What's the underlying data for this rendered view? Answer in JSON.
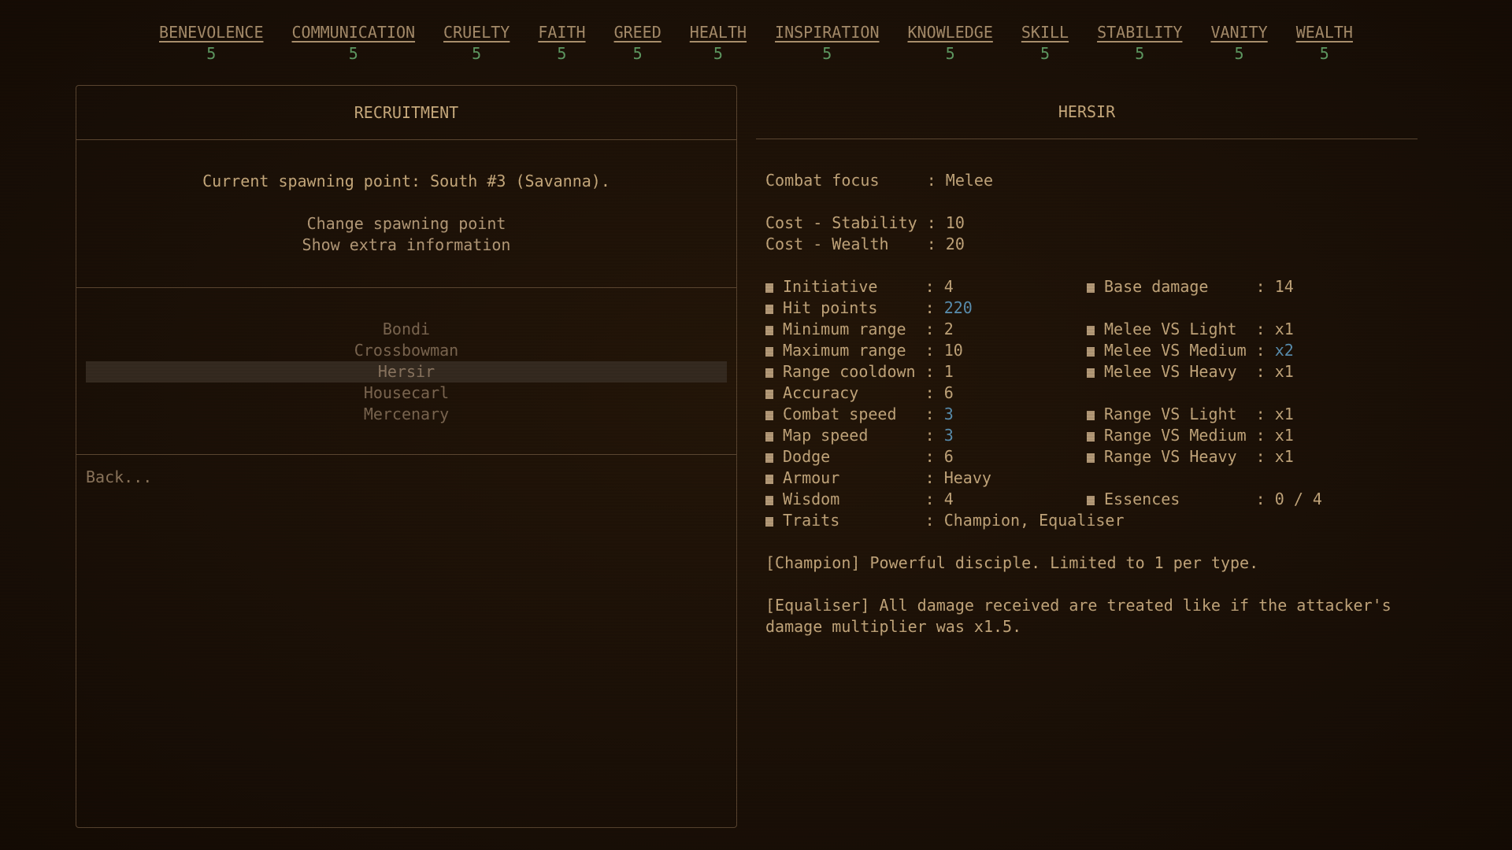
{
  "stats": [
    {
      "name": "BENEVOLENCE",
      "value": "5"
    },
    {
      "name": "COMMUNICATION",
      "value": "5"
    },
    {
      "name": "CRUELTY",
      "value": "5"
    },
    {
      "name": "FAITH",
      "value": "5"
    },
    {
      "name": "GREED",
      "value": "5"
    },
    {
      "name": "HEALTH",
      "value": "5"
    },
    {
      "name": "INSPIRATION",
      "value": "5"
    },
    {
      "name": "KNOWLEDGE",
      "value": "5"
    },
    {
      "name": "SKILL",
      "value": "5"
    },
    {
      "name": "STABILITY",
      "value": "5"
    },
    {
      "name": "VANITY",
      "value": "5"
    },
    {
      "name": "WEALTH",
      "value": "5"
    }
  ],
  "recruitment": {
    "title": "RECRUITMENT",
    "spawn_current": "Current spawning point: South #3 (Savanna).",
    "change_spawn": "Change spawning point",
    "show_extra": "Show extra information",
    "units": [
      "Bondi",
      "Crossbowman",
      "Hersir",
      "Housecarl",
      "Mercenary"
    ],
    "selected_unit": "Hersir",
    "back": "Back..."
  },
  "unit_detail": {
    "title": "HERSIR",
    "combat_focus": {
      "label": "Combat focus     : ",
      "value": "Melee"
    },
    "cost_stability": {
      "label": "Cost - Stability : ",
      "value": "10"
    },
    "cost_wealth": {
      "label": "Cost - Wealth    : ",
      "value": "20"
    },
    "left_stats": [
      {
        "label": "Initiative     : ",
        "value": "4",
        "highlight": false
      },
      {
        "label": "Hit points     : ",
        "value": "220",
        "highlight": true
      },
      {
        "label": "Minimum range  : ",
        "value": "2",
        "highlight": false
      },
      {
        "label": "Maximum range  : ",
        "value": "10",
        "highlight": false
      },
      {
        "label": "Range cooldown : ",
        "value": "1",
        "highlight": false
      },
      {
        "label": "Accuracy       : ",
        "value": "6",
        "highlight": false
      },
      {
        "label": "Combat speed   : ",
        "value": "3",
        "highlight": true
      },
      {
        "label": "Map speed      : ",
        "value": "3",
        "highlight": true
      },
      {
        "label": "Dodge          : ",
        "value": "6",
        "highlight": false
      },
      {
        "label": "Armour         : ",
        "value": "Heavy",
        "highlight": false
      },
      {
        "label": "Wisdom         : ",
        "value": "4",
        "highlight": false
      },
      {
        "label": "Traits         : ",
        "value": "Champion, Equaliser",
        "highlight": false
      }
    ],
    "right_stats": [
      {
        "row": 0,
        "label": "Base damage     : ",
        "value": "14",
        "highlight": false
      },
      {
        "row": 2,
        "label": "Melee VS Light  : ",
        "value": "x1",
        "highlight": false
      },
      {
        "row": 3,
        "label": "Melee VS Medium : ",
        "value": "x2",
        "highlight": true
      },
      {
        "row": 4,
        "label": "Melee VS Heavy  : ",
        "value": "x1",
        "highlight": false
      },
      {
        "row": 6,
        "label": "Range VS Light  : ",
        "value": "x1",
        "highlight": false
      },
      {
        "row": 7,
        "label": "Range VS Medium : ",
        "value": "x1",
        "highlight": false
      },
      {
        "row": 8,
        "label": "Range VS Heavy  : ",
        "value": "x1",
        "highlight": false
      },
      {
        "row": 10,
        "label": "Essences        : ",
        "value": "0 / 4",
        "highlight": false
      }
    ],
    "trait_champion": "[Champion] Powerful disciple. Limited to 1 per type.",
    "trait_equaliser": "[Equaliser] All damage received are treated like if the attacker's damage multiplier was x1.5."
  }
}
